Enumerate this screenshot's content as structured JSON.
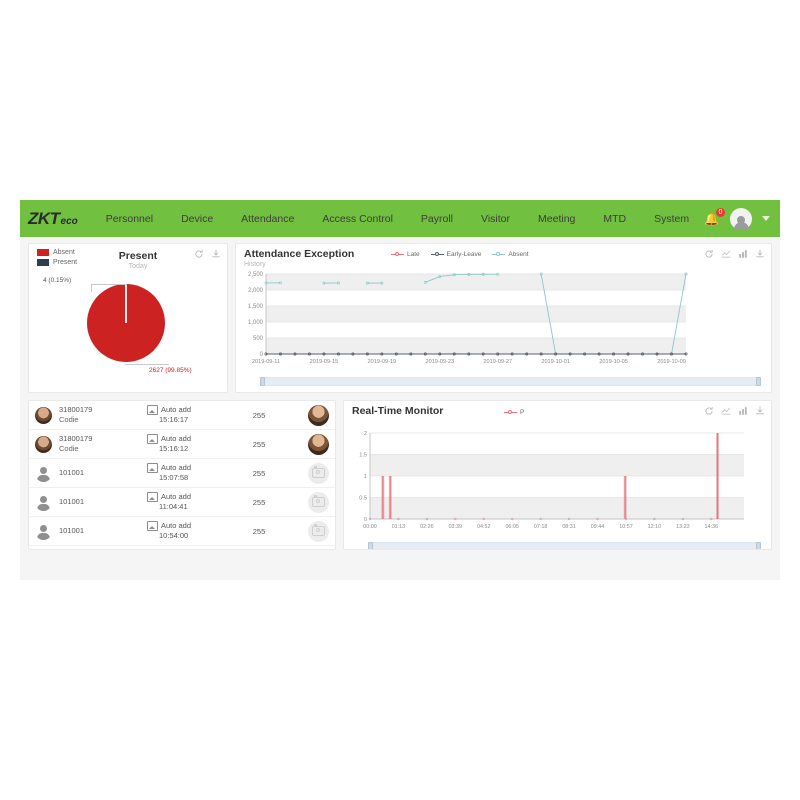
{
  "theme": {
    "green": "#72c040",
    "red": "#cc2222",
    "navy": "#2c3e50",
    "teal": "#8fc7c9"
  },
  "navbar": {
    "logo_main": "ZKT",
    "logo_suffix": "eco",
    "items": [
      {
        "label": "Personnel"
      },
      {
        "label": "Device"
      },
      {
        "label": "Attendance"
      },
      {
        "label": "Access Control"
      },
      {
        "label": "Payroll"
      },
      {
        "label": "Visitor"
      },
      {
        "label": "Meeting"
      },
      {
        "label": "MTD"
      },
      {
        "label": "System"
      }
    ],
    "notification_count": "0",
    "bell_icon": "bell-icon",
    "avatar_icon": "user-avatar-icon",
    "caret_icon": "chevron-down-icon"
  },
  "pie_card": {
    "title": "Present",
    "subtitle": "Today",
    "legend": [
      {
        "label": "Absent",
        "color": "#cc2222"
      },
      {
        "label": "Present",
        "color": "#2c3e50"
      }
    ],
    "labels": {
      "present": "4 (0.15%)",
      "absent": "2627 (99.85%)"
    },
    "tools": [
      {
        "name": "refresh-icon"
      },
      {
        "name": "download-icon"
      }
    ]
  },
  "exception_card": {
    "title": "Attendance Exception",
    "subtitle": "History",
    "legend": [
      {
        "label": "Late",
        "color": "#e4717a"
      },
      {
        "label": "Early-Leave",
        "color": "#55606b"
      },
      {
        "label": "Absent",
        "color": "#8fc7c9"
      }
    ],
    "tools": [
      {
        "name": "refresh-icon"
      },
      {
        "name": "line-chart-icon"
      },
      {
        "name": "bar-chart-icon"
      },
      {
        "name": "download-icon"
      }
    ]
  },
  "list_card": {
    "rows": [
      {
        "id": "31800179",
        "name": "Codie",
        "event": "Auto add",
        "time": "15:16:17",
        "value": "255",
        "avatar": "photo",
        "thumb": "photo"
      },
      {
        "id": "31800179",
        "name": "Codie",
        "event": "Auto add",
        "time": "15:16:12",
        "value": "255",
        "avatar": "photo",
        "thumb": "photo"
      },
      {
        "id": "101001",
        "name": "",
        "event": "Auto add",
        "time": "15:07:58",
        "value": "255",
        "avatar": "person",
        "thumb": "placeholder"
      },
      {
        "id": "101001",
        "name": "",
        "event": "Auto add",
        "time": "11:04:41",
        "value": "255",
        "avatar": "person",
        "thumb": "placeholder"
      },
      {
        "id": "101001",
        "name": "",
        "event": "Auto add",
        "time": "10:54:00",
        "value": "255",
        "avatar": "person",
        "thumb": "placeholder"
      }
    ]
  },
  "monitor_card": {
    "title": "Real-Time Monitor",
    "legend": [
      {
        "label": "P",
        "color": "#e4717a"
      }
    ],
    "tools": [
      {
        "name": "refresh-icon"
      },
      {
        "name": "line-chart-icon"
      },
      {
        "name": "bar-chart-icon"
      },
      {
        "name": "download-icon"
      }
    ]
  },
  "chart_data": [
    {
      "id": "attendance_exception",
      "type": "line",
      "title": "Attendance Exception",
      "subtitle": "History",
      "xlabel": "",
      "ylabel": "",
      "ylim": [
        0,
        2500
      ],
      "yticks": [
        "0",
        "500",
        "1,000",
        "1,500",
        "2,000",
        "2,500"
      ],
      "grid": true,
      "legend_position": "top-center",
      "x": [
        "2019-09-11",
        "2019-09-12",
        "2019-09-13",
        "2019-09-14",
        "2019-09-15",
        "2019-09-16",
        "2019-09-17",
        "2019-09-18",
        "2019-09-19",
        "2019-09-20",
        "2019-09-21",
        "2019-09-22",
        "2019-09-23",
        "2019-09-24",
        "2019-09-25",
        "2019-09-26",
        "2019-09-27",
        "2019-09-28",
        "2019-09-29",
        "2019-09-30",
        "2019-10-01",
        "2019-10-02",
        "2019-10-03",
        "2019-10-04",
        "2019-10-05",
        "2019-10-06",
        "2019-10-07",
        "2019-10-08",
        "2019-10-09",
        "2019-10-10"
      ],
      "xticks": [
        "2019-09-11",
        "2019-09-15",
        "2019-09-19",
        "2019-09-23",
        "2019-09-27",
        "2019-10-01",
        "2019-10-05",
        "2019-10-09"
      ],
      "series": [
        {
          "name": "Absent",
          "color": "#8fc7c9",
          "values": [
            2220,
            2225,
            null,
            null,
            2215,
            2220,
            null,
            2215,
            2218,
            null,
            null,
            2240,
            2420,
            2480,
            2490,
            2492,
            2495,
            null,
            null,
            2500,
            0,
            0,
            0,
            0,
            0,
            0,
            0,
            0,
            0,
            2500
          ]
        },
        {
          "name": "Late",
          "color": "#e4717a",
          "values": [
            0,
            0,
            0,
            0,
            0,
            0,
            0,
            0,
            0,
            0,
            0,
            0,
            2,
            4,
            3,
            2,
            1,
            0,
            0,
            0,
            0,
            0,
            0,
            0,
            0,
            0,
            0,
            0,
            0,
            0
          ]
        },
        {
          "name": "Early-Leave",
          "color": "#55606b",
          "values": [
            0,
            0,
            0,
            0,
            0,
            0,
            0,
            0,
            0,
            0,
            0,
            0,
            0,
            0,
            0,
            0,
            0,
            0,
            0,
            0,
            0,
            0,
            0,
            0,
            0,
            0,
            0,
            0,
            0,
            0
          ]
        }
      ]
    },
    {
      "id": "real_time_monitor",
      "type": "bar",
      "title": "Real-Time Monitor",
      "xlabel": "",
      "ylabel": "",
      "ylim": [
        0,
        2
      ],
      "yticks": [
        "0",
        "0.5",
        "1",
        "1.5",
        "2"
      ],
      "grid": true,
      "legend_position": "top-center",
      "xticks": [
        "00:00",
        "01:13",
        "02:26",
        "03:39",
        "04:52",
        "06:05",
        "07:18",
        "08:31",
        "09:44",
        "10:57",
        "12:10",
        "13:23",
        "14:36"
      ],
      "series": [
        {
          "name": "P",
          "color": "#e4717a",
          "points": [
            {
              "x": "00:33",
              "y": 1
            },
            {
              "x": "00:52",
              "y": 1
            },
            {
              "x": "10:55",
              "y": 1
            },
            {
              "x": "14:52",
              "y": 2
            }
          ]
        }
      ]
    }
  ]
}
